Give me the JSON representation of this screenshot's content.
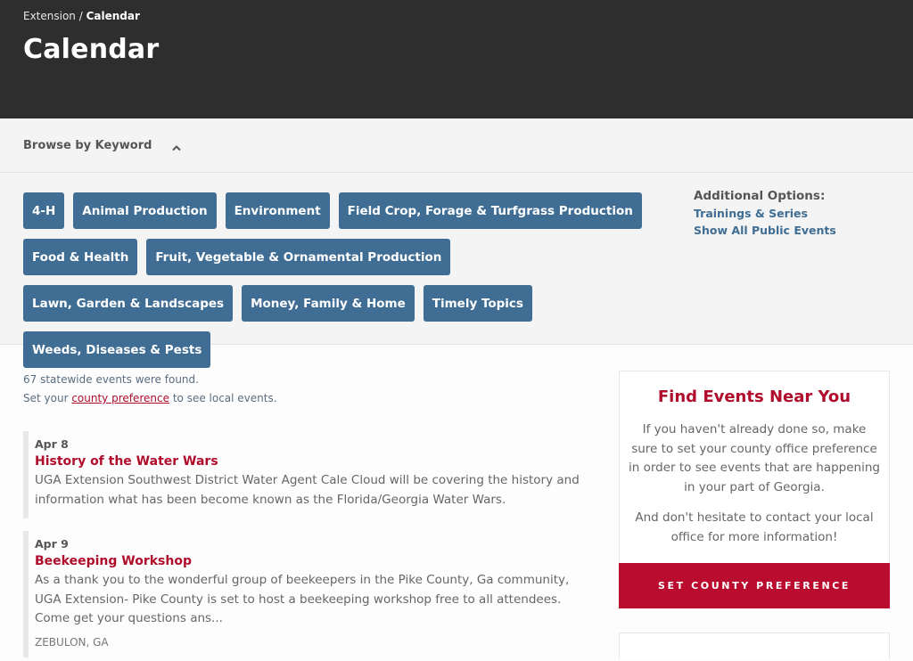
{
  "header": {
    "breadcrumb": {
      "parent": "Extension",
      "separator": " / ",
      "current": "Calendar"
    },
    "title": "Calendar"
  },
  "browse": {
    "label": "Browse by Keyword",
    "toggle_icon": "chevron-up-icon",
    "keywords": [
      "4-H",
      "Animal Production",
      "Environment",
      "Field Crop, Forage & Turfgrass Production",
      "Food & Health",
      "Fruit, Vegetable & Ornamental Production",
      "Lawn, Garden & Landscapes",
      "Money, Family & Home",
      "Timely Topics",
      "Weeds, Diseases & Pests"
    ],
    "additional_options": {
      "title": "Additional Options:",
      "links": [
        "Trainings & Series",
        "Show All Public Events"
      ]
    }
  },
  "results": {
    "count_text": "67 statewide events were found.",
    "pref_prefix": "Set your ",
    "pref_link": "county preference",
    "pref_suffix": " to see local events."
  },
  "events": [
    {
      "date": "Apr 8",
      "title": "History of the Water Wars",
      "description": "UGA Extension Southwest District Water Agent Cale Cloud will be covering the history and information what has been become known as the Florida/Georgia Water Wars.",
      "location": ""
    },
    {
      "date": "Apr 9",
      "title": "Beekeeping Workshop",
      "description": "As a thank you to the wonderful group of beekeepers in the Pike County, Ga community, UGA Extension- Pike County is set to host a beekeeping workshop free to all attendees. Come get your questions ans...",
      "location": "ZEBULON, GA"
    }
  ],
  "sidebar": {
    "title": "Find Events Near You",
    "paragraph1": "If you haven't already done so, make sure to set your county office preference in order to see events that are happening in your part of Georgia.",
    "paragraph2": "And don't hesitate to contact your local office for more information!",
    "button_label": "SET COUNTY PREFERENCE"
  },
  "colors": {
    "header_bg": "#2e2e2e",
    "tag_bg": "#3f6d94",
    "accent_red": "#ba0c2f",
    "link_blue": "#3f6d94"
  }
}
